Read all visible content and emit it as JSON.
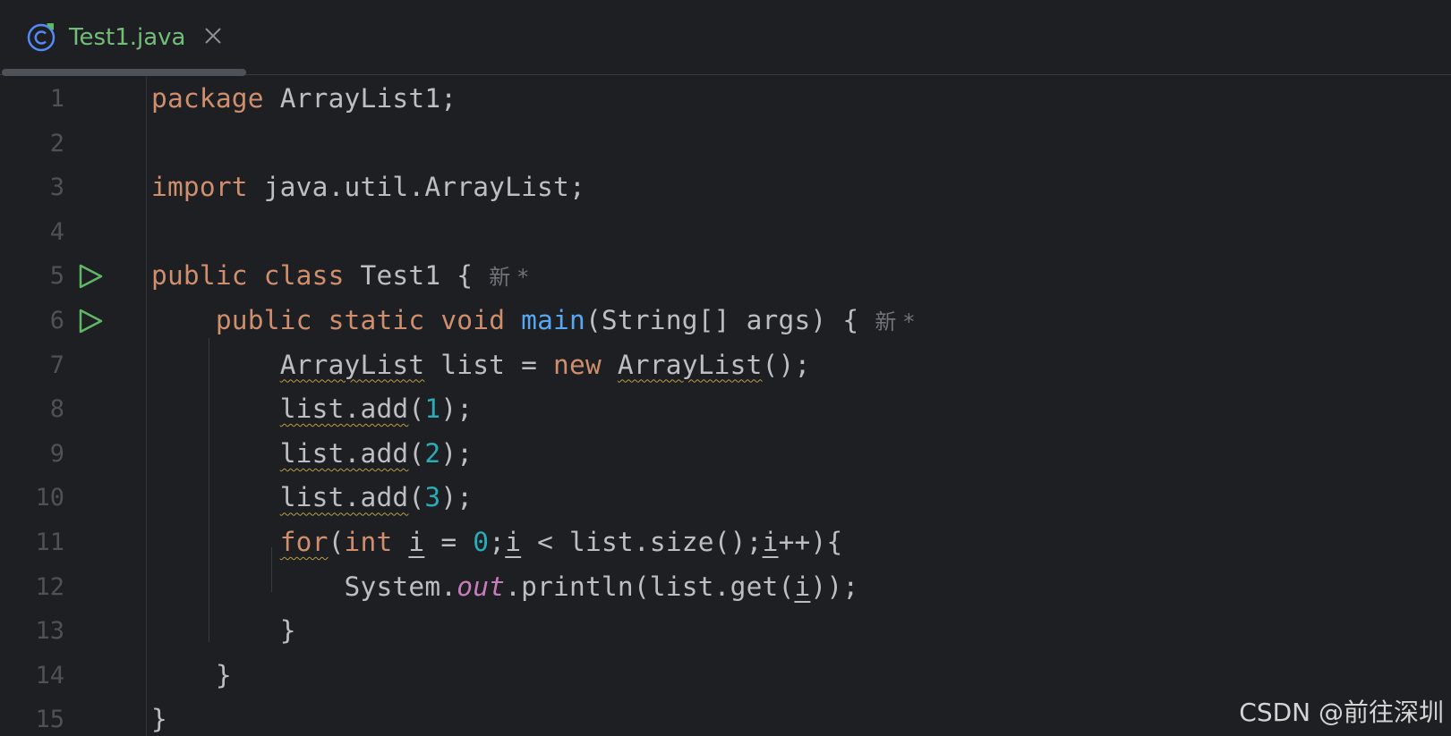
{
  "tab": {
    "label": "Test1.java",
    "icon": "java-class-icon",
    "close_icon": "close-icon"
  },
  "line_numbers": [
    "1",
    "2",
    "3",
    "4",
    "5",
    "6",
    "7",
    "8",
    "9",
    "10",
    "11",
    "12",
    "13",
    "14",
    "15"
  ],
  "code": {
    "l1_kw": "package",
    "l1_rest": " ArrayList1;",
    "l3_kw": "import",
    "l3_rest": " java.util.ArrayList;",
    "l5_public": "public",
    "l5_class": "class",
    "l5_rest": " Test1 {",
    "l5_hint": "新 *",
    "l6_public": "public",
    "l6_static": "static",
    "l6_void": "void",
    "l6_main": "main",
    "l6_rest": "(String[] args) {",
    "l6_hint": "新 *",
    "l7_type": "ArrayList",
    "l7_mid": " list = ",
    "l7_new": "new",
    "l7_ctor": "ArrayList",
    "l7_end": "();",
    "l8_call": "list.add",
    "l8_open": "(",
    "l8_num": "1",
    "l8_end": ");",
    "l9_call": "list.add",
    "l9_open": "(",
    "l9_num": "2",
    "l9_end": ");",
    "l10_call": "list.add",
    "l10_open": "(",
    "l10_num": "3",
    "l10_end": ");",
    "l11_for": "for",
    "l11_open": "(",
    "l11_int": "int",
    "l11_i1": "i",
    "l11_eq": " = ",
    "l11_zero": "0",
    "l11_semi": ";",
    "l11_i2": "i",
    "l11_mid": " < list.size();",
    "l11_i3": "i",
    "l11_end": "++){",
    "l12_sys": "System.",
    "l12_out": "out",
    "l12_mid": ".println(list.get(",
    "l12_i": "i",
    "l12_end": "));",
    "l13": "}",
    "l14": "}",
    "l15": "}"
  },
  "watermark": "CSDN @前往深圳",
  "colors": {
    "background": "#1e1f22",
    "keyword": "#cf8e6d",
    "function": "#56a8f5",
    "number": "#2aacb8",
    "static_field": "#c77dbb",
    "text": "#bcbec4",
    "tab_label": "#73bd79",
    "run_icon": "#5fb865"
  }
}
